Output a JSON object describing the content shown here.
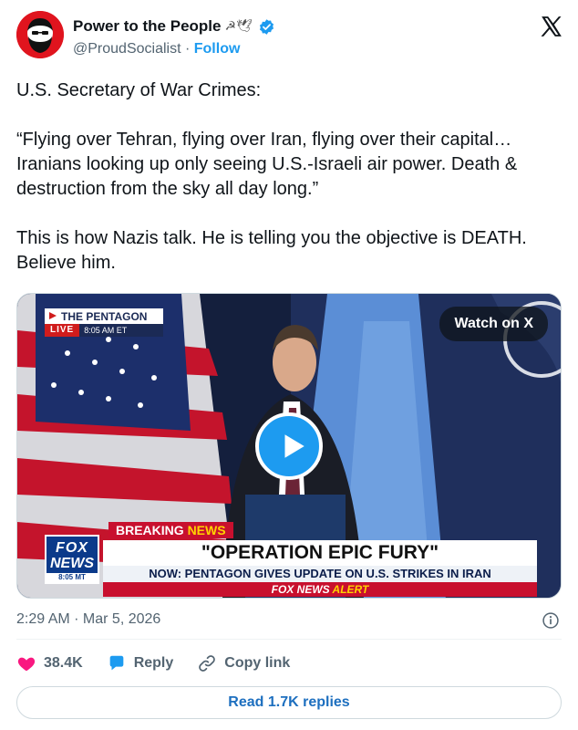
{
  "header": {
    "display_name": "Power to the People",
    "name_emojis": "☭🕊",
    "handle": "@ProudSocialist",
    "separator": "·",
    "follow_label": "Follow",
    "verified": true
  },
  "tweet": {
    "paragraphs": [
      "U.S. Secretary of War Crimes:",
      "“Flying over Tehran, flying over Iran, flying over their capital…Iranians looking up only seeing U.S.-Israeli air power. Death & destruction from the sky all day long.”",
      "This is how Nazis talk. He is telling you the objective is DEATH. Believe him."
    ]
  },
  "media": {
    "watch_label": "Watch on X",
    "badge_title": "THE PENTAGON",
    "badge_live": "LIVE",
    "badge_time": "8:05 AM ET",
    "breaking_prefix": "BREAKING ",
    "breaking_word": "NEWS",
    "headline": "\"OPERATION EPIC FURY\"",
    "subhead": "NOW: PENTAGON GIVES UPDATE ON U.S. STRIKES IN IRAN",
    "alert_brand": "FOX NEWS ",
    "alert_word": "ALERT",
    "logo_fox": "FOX",
    "logo_news": "NEWS",
    "logo_time": "8:05 MT"
  },
  "meta": {
    "timestamp": "2:29 AM · Mar 5, 2026"
  },
  "actions": {
    "likes": "38.4K",
    "reply_label": "Reply",
    "copy_label": "Copy link"
  },
  "footer": {
    "read_replies": "Read 1.7K replies"
  },
  "colors": {
    "accent": "#1d9bf0",
    "like": "#f91880",
    "text": "#0f1419",
    "muted": "#536471",
    "avatar_bg": "#e0141e"
  },
  "icons": {
    "verified": "verified-badge-icon",
    "x_logo": "x-logo-icon",
    "heart": "heart-icon",
    "reply": "reply-bubble-icon",
    "link": "link-icon",
    "info": "info-icon",
    "play": "play-icon"
  }
}
